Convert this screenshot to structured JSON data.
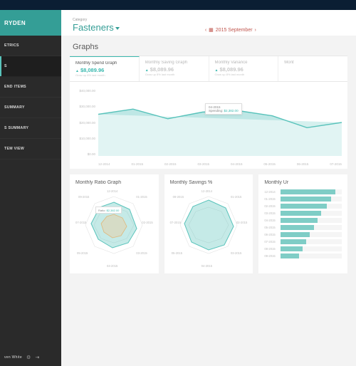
{
  "brand": "RYDEN",
  "sidebar": {
    "items": [
      {
        "label": "ETRICS"
      },
      {
        "label": "S"
      },
      {
        "label": "END ITEMS"
      },
      {
        "label": "SUMMARY"
      },
      {
        "label": "S SUMMARY"
      },
      {
        "label": "TEM VIEW"
      }
    ],
    "user": "ven White"
  },
  "header": {
    "category_label": "Category",
    "category_value": "Fasteners",
    "date": "2015 September"
  },
  "section_title": "Graphs",
  "tabs": [
    {
      "title": "Monthly Spend Graph",
      "amount": "$8,089.96",
      "sub": "Grow up 8% last month",
      "active": true
    },
    {
      "title": "Monthly Saving Graph",
      "amount": "$8,089.96",
      "sub": "Grow up 8% last month",
      "active": false
    },
    {
      "title": "Monthly Variance",
      "amount": "$8,089.96",
      "sub": "Grow up 8% last month",
      "active": false
    },
    {
      "title": "Mont",
      "amount": "",
      "sub": "",
      "active": false
    }
  ],
  "chart_data": {
    "type": "line",
    "title": "Monthly Spend Graph",
    "ylabel": "",
    "ylim": [
      0,
      40000
    ],
    "y_ticks": [
      "$40,000.00",
      "$30,000.00",
      "$20,000.00",
      "$10,000.00",
      "$0.00"
    ],
    "categories": [
      "12-2014",
      "01-2015",
      "02-2015",
      "03-2015",
      "04-2015",
      "05-2015",
      "06-2015",
      "07-2015"
    ],
    "values": [
      25000,
      28000,
      22000,
      26000,
      27000,
      24000,
      17000,
      20000
    ],
    "highlight": {
      "x": "04-2015",
      "label": "Spending",
      "value": "$2,382.00"
    }
  },
  "cards": [
    {
      "title": "Monthly Ratio Graph",
      "type": "radar",
      "months": [
        "12-2014",
        "01-2015",
        "02-2015",
        "03-2015",
        "04-2015",
        "05-2015",
        "06-2015",
        "07-2015",
        "08-2015",
        "09-2015"
      ],
      "tooltip": {
        "label": "Ratio",
        "value": "$2,382.00"
      }
    },
    {
      "title": "Monthly Savings %",
      "type": "radar",
      "months": [
        "12-2014",
        "01-2015",
        "02-2015",
        "03-2015",
        "04-2015",
        "05-2015",
        "06-2015",
        "07-2015",
        "08-2015",
        "09-2015"
      ]
    },
    {
      "title": "Monthly Ur",
      "type": "bar",
      "months": [
        "12-2014",
        "01-2015",
        "02-2015",
        "03-2015",
        "04-2015",
        "05-2015",
        "06-2015",
        "07-2015",
        "08-2015",
        "09-2015"
      ],
      "values": [
        90,
        83,
        76,
        66,
        60,
        54,
        48,
        42,
        36,
        30
      ]
    }
  ]
}
